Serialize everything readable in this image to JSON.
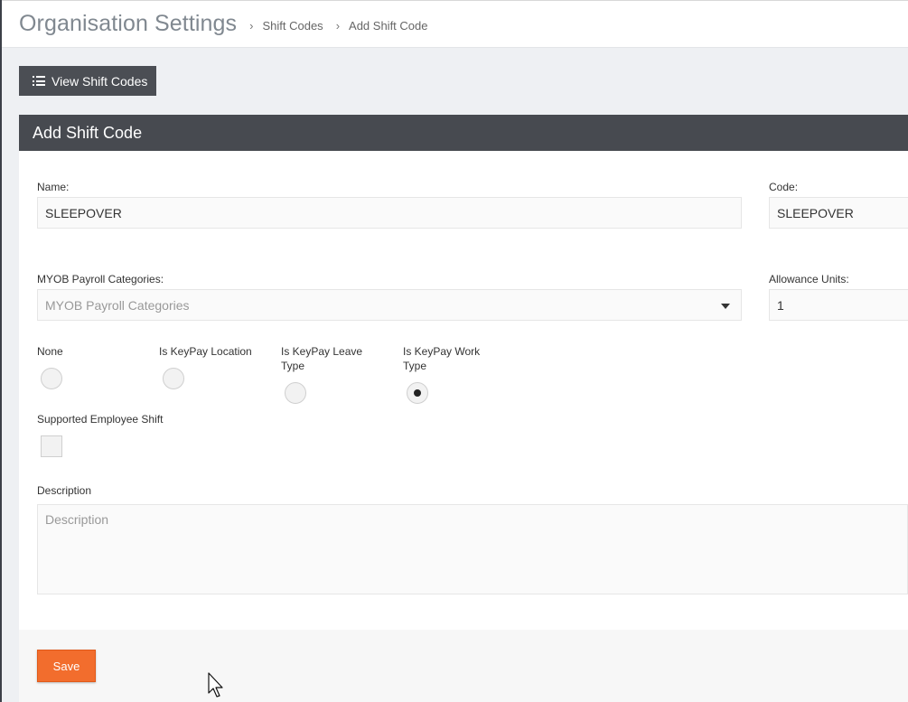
{
  "header": {
    "title": "Organisation Settings",
    "breadcrumb": [
      "Shift Codes",
      "Add Shift Code"
    ]
  },
  "toolbar": {
    "view_button_label": "View Shift Codes"
  },
  "panel": {
    "title": "Add Shift Code"
  },
  "form": {
    "name_label": "Name:",
    "name_value": "SLEEPOVER",
    "code_label": "Code:",
    "code_value": "SLEEPOVER",
    "payroll_label": "MYOB Payroll Categories:",
    "payroll_placeholder": "MYOB Payroll Categories",
    "allowance_label": "Allowance Units:",
    "allowance_value": "1",
    "radio_options": [
      {
        "label": "None",
        "checked": false
      },
      {
        "label": "Is KeyPay Location",
        "checked": false
      },
      {
        "label": "Is KeyPay Leave Type",
        "checked": false
      },
      {
        "label": "Is KeyPay Work Type",
        "checked": true
      }
    ],
    "supported_label": "Supported Employee Shift",
    "description_label": "Description",
    "description_placeholder": "Description",
    "save_label": "Save"
  },
  "colors": {
    "accent": "#f26d2d",
    "panel_header": "#474a50",
    "button_dark": "#4b4e54"
  }
}
